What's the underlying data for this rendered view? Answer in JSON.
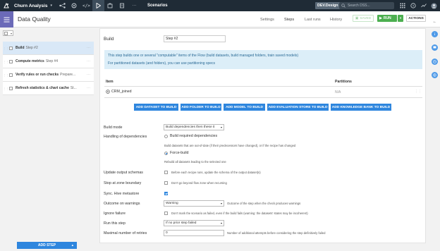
{
  "topnav": {
    "project": "Churn Analysis",
    "section": "Scenarios",
    "env": "DEV.Design",
    "search_placeholder": "Search DSS..."
  },
  "header": {
    "title": "Data Quality",
    "tabs": [
      {
        "label": "Settings"
      },
      {
        "label": "Steps"
      },
      {
        "label": "Last runs"
      },
      {
        "label": "History"
      }
    ],
    "saved_label": "SAVED",
    "run_label": "RUN",
    "actions_label": "ACTIONS"
  },
  "steps": [
    {
      "name": "Build",
      "sub": "Step #2"
    },
    {
      "name": "Compute metrics",
      "sub": "Step #4"
    },
    {
      "name": "Verify rules or run checks",
      "sub": "Prepare..."
    },
    {
      "name": "Refresh statistics & chart cache",
      "sub": "St..."
    }
  ],
  "add_step_label": "ADD STEP",
  "build": {
    "title": "Build",
    "step_name": "Step #2",
    "info_line1": "This step builds one or several \"computable\" items of the Flow (build datasets, build managed folders, train saved models)",
    "info_line2": "For partitioned datasets (and folders), you can use partitioning specs",
    "col_item": "Item",
    "col_partitions": "Partitions",
    "item_name": "CRM_joined",
    "item_partitions": "N/A",
    "buttons": {
      "dataset": "ADD DATASET TO BUILD",
      "folder": "ADD FOLDER TO BUILD",
      "model": "ADD MODEL TO BUILD",
      "eval": "ADD EVALUATION STORE TO BUILD",
      "kb": "ADD KNOWLEDGE BANK TO BUILD"
    }
  },
  "form": {
    "build_mode_label": "Build mode",
    "build_mode_value": "Build dependencies then these it",
    "handling_label": "Handling of dependencies",
    "opt_required": "Build required dependencies",
    "opt_required_help": "Build datasets that are out-of-date (if their predecessors have changed), or if the recipe has changed",
    "opt_force": "Force-build",
    "opt_force_help": "Rebuild all datasets leading to the selected one",
    "update_schemas_label": "Update output schemas",
    "update_schemas_help": "Before each recipe runs, update the schema of the output dataset(s)",
    "stop_zone_label": "Stop at zone boundary",
    "stop_zone_help": "Don't go beyond flow zone when recursing",
    "sync_hive_label": "Sync. Hive metastore",
    "outcome_label": "Outcome on warnings",
    "outcome_value": "Warning",
    "outcome_help": "Outcome of the step when the check produces warnings",
    "ignore_failure_label": "Ignore failure",
    "ignore_failure_help": "Don't mark the scenario as failed, even if the build fails (warning: the datasets' states may be incoherent)",
    "run_step_label": "Run this step",
    "run_step_value": "If no prior step failed",
    "max_retries_label": "Maximal number of retries",
    "max_retries_value": "0",
    "max_retries_help": "Number of additional attempts before considering the step definitively failed"
  }
}
